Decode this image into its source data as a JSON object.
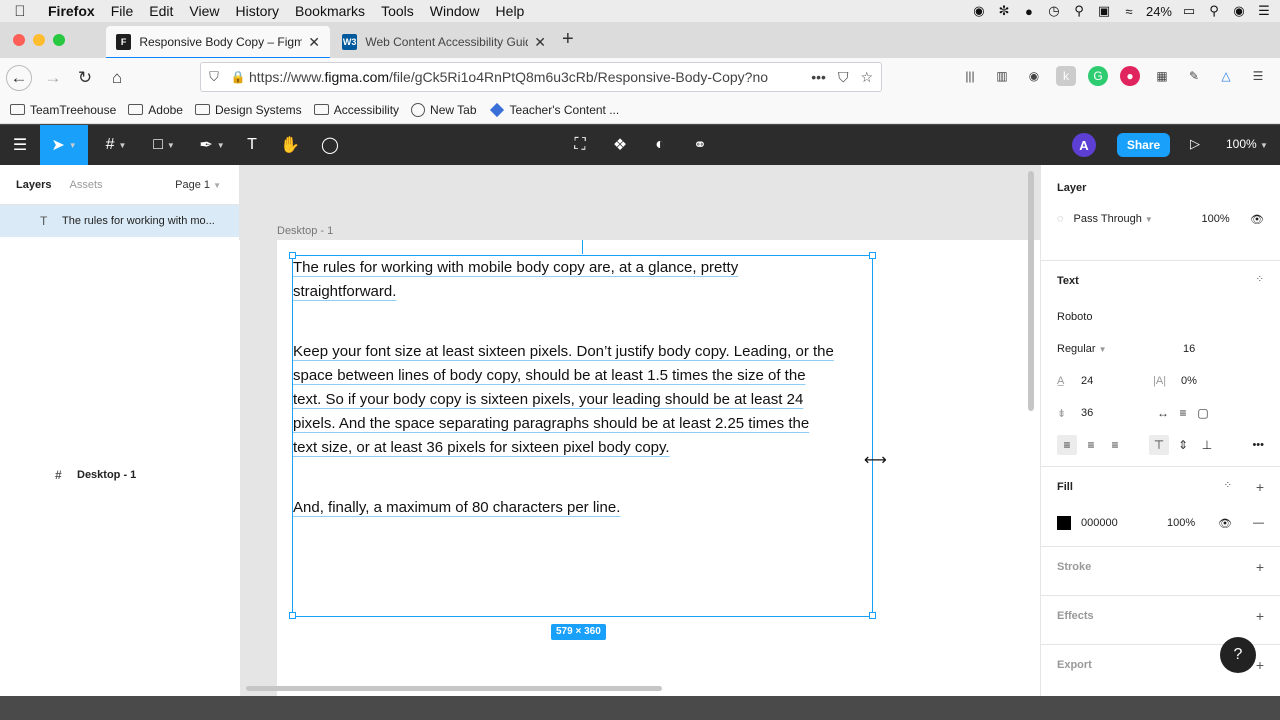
{
  "menubar": {
    "app": "Firefox",
    "items": [
      "File",
      "Edit",
      "View",
      "History",
      "Bookmarks",
      "Tools",
      "Window",
      "Help"
    ],
    "battery": "24%"
  },
  "tabs": [
    {
      "title": "Responsive Body Copy – Figma",
      "favicon": "F"
    },
    {
      "title": "Web Content Accessibility Guid",
      "favicon": "W3"
    }
  ],
  "url": {
    "prefix": "https://www.",
    "domain": "figma.com",
    "rest": "/file/gCk5Ri1o4RnPtQ8m6u3cRb/Responsive-Body-Copy?no"
  },
  "bookmarks": [
    {
      "label": "TeamTreehouse",
      "icon": "folder"
    },
    {
      "label": "Adobe",
      "icon": "folder"
    },
    {
      "label": "Design Systems",
      "icon": "folder"
    },
    {
      "label": "Accessibility",
      "icon": "folder"
    },
    {
      "label": "New Tab",
      "icon": "globe"
    },
    {
      "label": "Teacher's Content ...",
      "icon": "diamond"
    }
  ],
  "figma_toolbar": {
    "avatar_letter": "A",
    "share_label": "Share",
    "zoom": "100%"
  },
  "layers_panel": {
    "tab_layers": "Layers",
    "tab_assets": "Assets",
    "page": "Page 1",
    "frame_name": "Desktop - 1",
    "text_layer": "The rules for working with mo..."
  },
  "canvas": {
    "frame_label": "Desktop - 1",
    "paragraphs": [
      [
        "The rules for working with mobile body copy are, at a glance, pretty",
        "straightforward."
      ],
      [
        "Keep your font size at least sixteen pixels. Don’t justify body copy. Leading, or the",
        "space between lines of body copy, should be at least 1.5 times the size of the",
        "text. So if your body copy is sixteen pixels, your leading should be at least 24",
        "pixels. And the space separating paragraphs should be at least 2.25 times the",
        "text size, or at least 36 pixels for sixteen pixel body copy."
      ],
      [
        "And, finally, a maximum of 80 characters per line."
      ]
    ],
    "dimensions": "579 × 360"
  },
  "properties": {
    "layer_title": "Layer",
    "blend_mode": "Pass Through",
    "layer_opacity": "100%",
    "text_title": "Text",
    "font_family": "Roboto",
    "font_weight": "Regular",
    "font_size": "16",
    "line_height": "24",
    "letter_spacing": "0%",
    "paragraph_spacing": "36",
    "fill_title": "Fill",
    "fill_hex": "000000",
    "fill_opacity": "100%",
    "stroke_title": "Stroke",
    "effects_title": "Effects",
    "export_title": "Export"
  },
  "colors": {
    "accent": "#18a0fb",
    "toolbar": "#2c2c2c",
    "avatar": "#5d3fd3"
  }
}
